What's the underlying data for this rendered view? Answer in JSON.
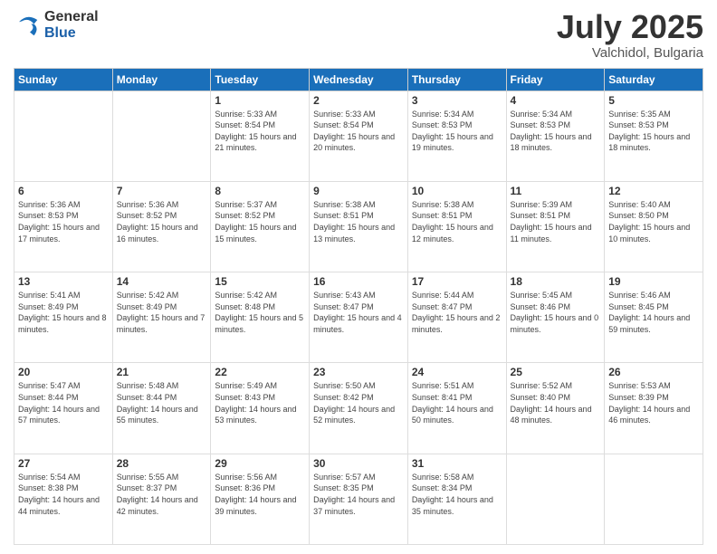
{
  "logo": {
    "general": "General",
    "blue": "Blue"
  },
  "header": {
    "month": "July 2025",
    "location": "Valchidol, Bulgaria"
  },
  "days_of_week": [
    "Sunday",
    "Monday",
    "Tuesday",
    "Wednesday",
    "Thursday",
    "Friday",
    "Saturday"
  ],
  "weeks": [
    [
      {
        "day": "",
        "sunrise": "",
        "sunset": "",
        "daylight": ""
      },
      {
        "day": "",
        "sunrise": "",
        "sunset": "",
        "daylight": ""
      },
      {
        "day": "1",
        "sunrise": "Sunrise: 5:33 AM",
        "sunset": "Sunset: 8:54 PM",
        "daylight": "Daylight: 15 hours and 21 minutes."
      },
      {
        "day": "2",
        "sunrise": "Sunrise: 5:33 AM",
        "sunset": "Sunset: 8:54 PM",
        "daylight": "Daylight: 15 hours and 20 minutes."
      },
      {
        "day": "3",
        "sunrise": "Sunrise: 5:34 AM",
        "sunset": "Sunset: 8:53 PM",
        "daylight": "Daylight: 15 hours and 19 minutes."
      },
      {
        "day": "4",
        "sunrise": "Sunrise: 5:34 AM",
        "sunset": "Sunset: 8:53 PM",
        "daylight": "Daylight: 15 hours and 18 minutes."
      },
      {
        "day": "5",
        "sunrise": "Sunrise: 5:35 AM",
        "sunset": "Sunset: 8:53 PM",
        "daylight": "Daylight: 15 hours and 18 minutes."
      }
    ],
    [
      {
        "day": "6",
        "sunrise": "Sunrise: 5:36 AM",
        "sunset": "Sunset: 8:53 PM",
        "daylight": "Daylight: 15 hours and 17 minutes."
      },
      {
        "day": "7",
        "sunrise": "Sunrise: 5:36 AM",
        "sunset": "Sunset: 8:52 PM",
        "daylight": "Daylight: 15 hours and 16 minutes."
      },
      {
        "day": "8",
        "sunrise": "Sunrise: 5:37 AM",
        "sunset": "Sunset: 8:52 PM",
        "daylight": "Daylight: 15 hours and 15 minutes."
      },
      {
        "day": "9",
        "sunrise": "Sunrise: 5:38 AM",
        "sunset": "Sunset: 8:51 PM",
        "daylight": "Daylight: 15 hours and 13 minutes."
      },
      {
        "day": "10",
        "sunrise": "Sunrise: 5:38 AM",
        "sunset": "Sunset: 8:51 PM",
        "daylight": "Daylight: 15 hours and 12 minutes."
      },
      {
        "day": "11",
        "sunrise": "Sunrise: 5:39 AM",
        "sunset": "Sunset: 8:51 PM",
        "daylight": "Daylight: 15 hours and 11 minutes."
      },
      {
        "day": "12",
        "sunrise": "Sunrise: 5:40 AM",
        "sunset": "Sunset: 8:50 PM",
        "daylight": "Daylight: 15 hours and 10 minutes."
      }
    ],
    [
      {
        "day": "13",
        "sunrise": "Sunrise: 5:41 AM",
        "sunset": "Sunset: 8:49 PM",
        "daylight": "Daylight: 15 hours and 8 minutes."
      },
      {
        "day": "14",
        "sunrise": "Sunrise: 5:42 AM",
        "sunset": "Sunset: 8:49 PM",
        "daylight": "Daylight: 15 hours and 7 minutes."
      },
      {
        "day": "15",
        "sunrise": "Sunrise: 5:42 AM",
        "sunset": "Sunset: 8:48 PM",
        "daylight": "Daylight: 15 hours and 5 minutes."
      },
      {
        "day": "16",
        "sunrise": "Sunrise: 5:43 AM",
        "sunset": "Sunset: 8:47 PM",
        "daylight": "Daylight: 15 hours and 4 minutes."
      },
      {
        "day": "17",
        "sunrise": "Sunrise: 5:44 AM",
        "sunset": "Sunset: 8:47 PM",
        "daylight": "Daylight: 15 hours and 2 minutes."
      },
      {
        "day": "18",
        "sunrise": "Sunrise: 5:45 AM",
        "sunset": "Sunset: 8:46 PM",
        "daylight": "Daylight: 15 hours and 0 minutes."
      },
      {
        "day": "19",
        "sunrise": "Sunrise: 5:46 AM",
        "sunset": "Sunset: 8:45 PM",
        "daylight": "Daylight: 14 hours and 59 minutes."
      }
    ],
    [
      {
        "day": "20",
        "sunrise": "Sunrise: 5:47 AM",
        "sunset": "Sunset: 8:44 PM",
        "daylight": "Daylight: 14 hours and 57 minutes."
      },
      {
        "day": "21",
        "sunrise": "Sunrise: 5:48 AM",
        "sunset": "Sunset: 8:44 PM",
        "daylight": "Daylight: 14 hours and 55 minutes."
      },
      {
        "day": "22",
        "sunrise": "Sunrise: 5:49 AM",
        "sunset": "Sunset: 8:43 PM",
        "daylight": "Daylight: 14 hours and 53 minutes."
      },
      {
        "day": "23",
        "sunrise": "Sunrise: 5:50 AM",
        "sunset": "Sunset: 8:42 PM",
        "daylight": "Daylight: 14 hours and 52 minutes."
      },
      {
        "day": "24",
        "sunrise": "Sunrise: 5:51 AM",
        "sunset": "Sunset: 8:41 PM",
        "daylight": "Daylight: 14 hours and 50 minutes."
      },
      {
        "day": "25",
        "sunrise": "Sunrise: 5:52 AM",
        "sunset": "Sunset: 8:40 PM",
        "daylight": "Daylight: 14 hours and 48 minutes."
      },
      {
        "day": "26",
        "sunrise": "Sunrise: 5:53 AM",
        "sunset": "Sunset: 8:39 PM",
        "daylight": "Daylight: 14 hours and 46 minutes."
      }
    ],
    [
      {
        "day": "27",
        "sunrise": "Sunrise: 5:54 AM",
        "sunset": "Sunset: 8:38 PM",
        "daylight": "Daylight: 14 hours and 44 minutes."
      },
      {
        "day": "28",
        "sunrise": "Sunrise: 5:55 AM",
        "sunset": "Sunset: 8:37 PM",
        "daylight": "Daylight: 14 hours and 42 minutes."
      },
      {
        "day": "29",
        "sunrise": "Sunrise: 5:56 AM",
        "sunset": "Sunset: 8:36 PM",
        "daylight": "Daylight: 14 hours and 39 minutes."
      },
      {
        "day": "30",
        "sunrise": "Sunrise: 5:57 AM",
        "sunset": "Sunset: 8:35 PM",
        "daylight": "Daylight: 14 hours and 37 minutes."
      },
      {
        "day": "31",
        "sunrise": "Sunrise: 5:58 AM",
        "sunset": "Sunset: 8:34 PM",
        "daylight": "Daylight: 14 hours and 35 minutes."
      },
      {
        "day": "",
        "sunrise": "",
        "sunset": "",
        "daylight": ""
      },
      {
        "day": "",
        "sunrise": "",
        "sunset": "",
        "daylight": ""
      }
    ]
  ]
}
